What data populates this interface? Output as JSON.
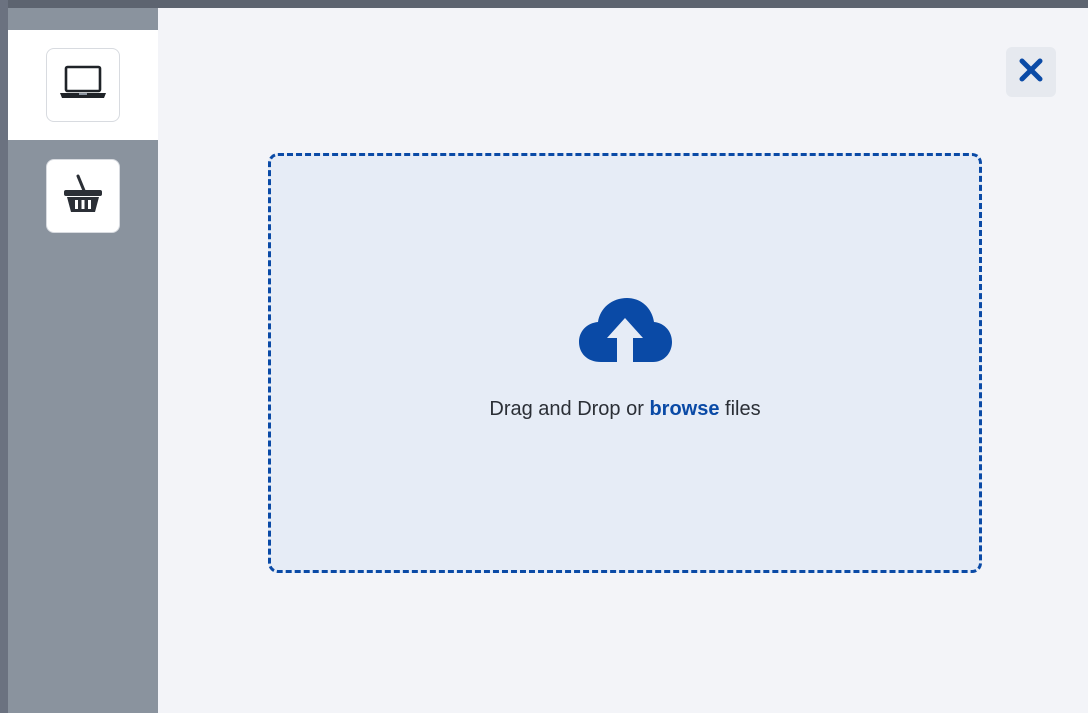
{
  "sidebar": {
    "items": [
      {
        "icon": "laptop-icon",
        "active": true
      },
      {
        "icon": "basket-icon",
        "active": false
      }
    ]
  },
  "dialog": {
    "close_icon": "close-icon"
  },
  "dropzone": {
    "icon": "cloud-upload-icon",
    "text_before": "Drag and Drop or ",
    "browse_label": "browse",
    "text_after": " files"
  },
  "colors": {
    "accent": "#0a4aa6",
    "sidebar_bg": "#8a939e",
    "main_bg": "#f3f4f8",
    "dropzone_bg": "#e6ecf6"
  }
}
